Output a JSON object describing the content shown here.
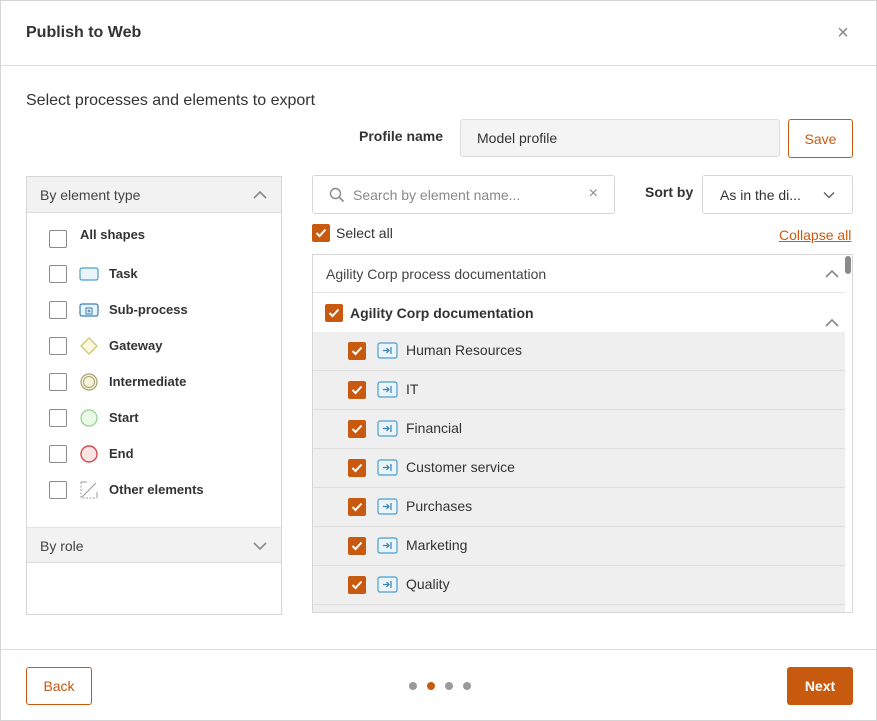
{
  "dialog": {
    "title": "Publish to Web",
    "close_glyph": "×",
    "subtitle": "Select processes and elements to export"
  },
  "profile": {
    "label": "Profile name",
    "value": "Model profile",
    "save_label": "Save"
  },
  "filters": {
    "element_type_header": "By element type",
    "all_shapes_label": "All shapes",
    "shapes": [
      {
        "label": "Task",
        "icon": "task-icon"
      },
      {
        "label": "Sub-process",
        "icon": "sub-process-icon"
      },
      {
        "label": "Gateway",
        "icon": "gateway-icon"
      },
      {
        "label": "Intermediate",
        "icon": "intermediate-event-icon"
      },
      {
        "label": "Start",
        "icon": "start-event-icon"
      },
      {
        "label": "End",
        "icon": "end-event-icon"
      },
      {
        "label": "Other elements",
        "icon": "other-elements-icon"
      }
    ],
    "role_header": "By role"
  },
  "search": {
    "placeholder": "Search by element name...",
    "value": "",
    "clear_glyph": "×"
  },
  "sort": {
    "label": "Sort by",
    "value": "As in the di..."
  },
  "select_all_label": "Select all",
  "collapse_all_label": "Collapse all",
  "tree": {
    "root_label": "Agility Corp process documentation",
    "group_label": "Agility Corp documentation",
    "items": [
      {
        "label": "Human Resources"
      },
      {
        "label": "IT"
      },
      {
        "label": "Financial"
      },
      {
        "label": "Customer service"
      },
      {
        "label": "Purchases"
      },
      {
        "label": "Marketing"
      },
      {
        "label": "Quality"
      }
    ]
  },
  "footer": {
    "back_label": "Back",
    "next_label": "Next",
    "steps_total": 4,
    "current_step": 2
  },
  "colors": {
    "accent": "#c85a10",
    "task_icon": "#4a9ec9",
    "gateway_icon": "#c9c26a",
    "start_icon": "#8fd28a",
    "end_icon": "#d24b4b"
  }
}
